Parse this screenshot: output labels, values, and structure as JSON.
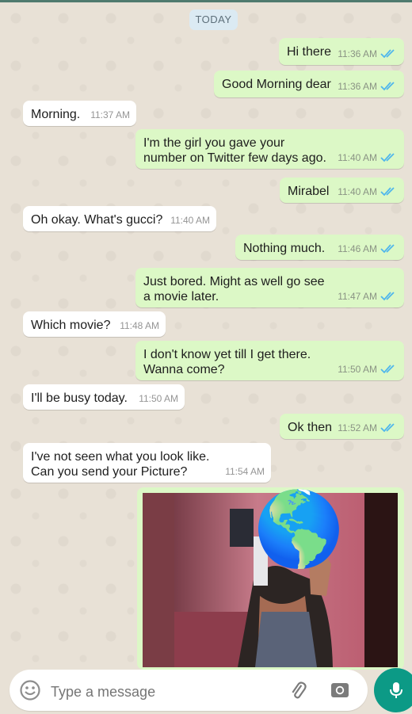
{
  "date_pill": "TODAY",
  "messages": [
    {
      "dir": "out",
      "text": "Hi there",
      "time": "11:36 AM"
    },
    {
      "dir": "out",
      "text": "Good Morning dear",
      "time": "11:36 AM"
    },
    {
      "dir": "in",
      "text": "Morning.",
      "time": "11:37 AM"
    },
    {
      "dir": "out",
      "text": "I'm the girl you gave your\nnumber on Twitter few days ago.",
      "time": "11:40 AM"
    },
    {
      "dir": "out",
      "text": "Mirabel",
      "time": "11:40 AM"
    },
    {
      "dir": "in",
      "text": "Oh okay. What's gucci?",
      "time": "11:40 AM"
    },
    {
      "dir": "out",
      "text": "Nothing much.",
      "time": "11:46 AM"
    },
    {
      "dir": "out",
      "text": "Just bored. Might as well go see\na movie later.",
      "time": "11:47 AM"
    },
    {
      "dir": "in",
      "text": "Which movie?",
      "time": "11:48 AM"
    },
    {
      "dir": "out",
      "text": "I don't know yet till I get there.\nWanna come?",
      "time": "11:50 AM"
    },
    {
      "dir": "in",
      "text": "I'll be busy today.",
      "time": "11:50 AM"
    },
    {
      "dir": "out",
      "text": "Ok then",
      "time": "11:52 AM"
    },
    {
      "dir": "in",
      "text": "I've not seen what you look like.\nCan you send your Picture?",
      "time": "11:54 AM"
    }
  ],
  "image_message": {
    "emoji": "🌎"
  },
  "input": {
    "placeholder": "Type a message"
  },
  "icons": {
    "emoji": "emoji-icon",
    "attach": "paperclip-icon",
    "camera": "camera-icon",
    "mic": "mic-icon",
    "read": "double-check-icon"
  },
  "colors": {
    "outgoing": "#dcf8c6",
    "incoming": "#ffffff",
    "tick": "#4fb6ec",
    "accent": "#0c9a86",
    "background": "#e8e1d6"
  }
}
